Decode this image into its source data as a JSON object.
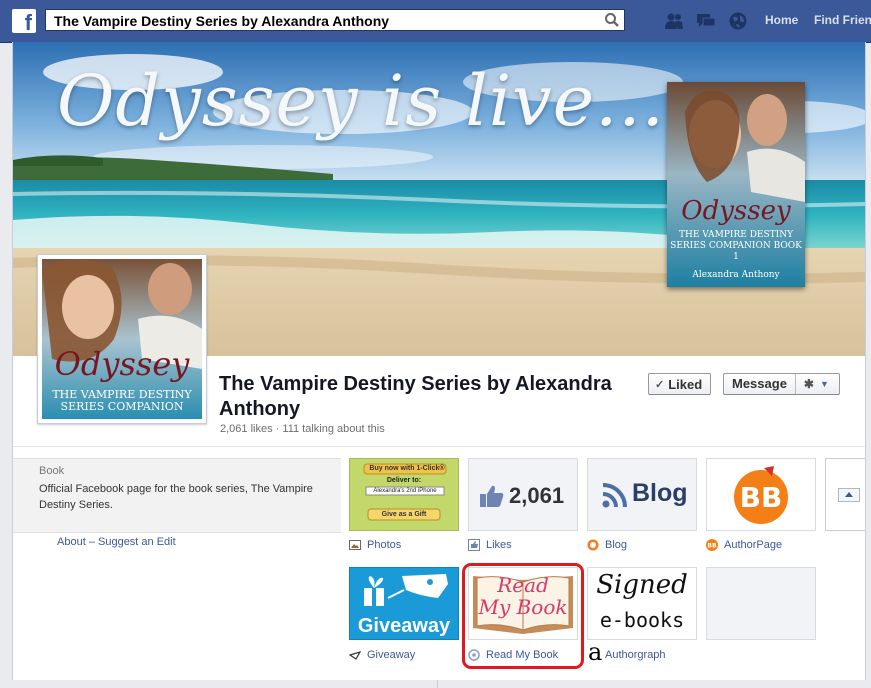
{
  "topbar": {
    "search_value": "The Vampire Destiny Series by Alexandra Anthony",
    "nav": [
      "Home",
      "Find Friends"
    ]
  },
  "cover": {
    "headline": "Odyssey is live...",
    "book_title": "Odyssey",
    "book_subtitle": "The Vampire Destiny Series Companion Book 1",
    "book_author": "Alexandra Anthony"
  },
  "profile": {
    "title": "Odyssey",
    "subtitle": "The Vampire Destiny Series Companion"
  },
  "page": {
    "name": "The Vampire Destiny Series by Alexandra Anthony",
    "likes": "2,061 likes",
    "separator": "·",
    "talking": "111 talking about this"
  },
  "actions": {
    "liked_check": "✓",
    "liked": "Liked",
    "message": "Message",
    "gear": "✱",
    "caret": "▼"
  },
  "about": {
    "category": "Book",
    "description": "Official Facebook page for the book series, The Vampire Destiny Series.",
    "about_link": "About",
    "separator": "–",
    "suggest_link": "Suggest an Edit"
  },
  "apps": {
    "photos": {
      "label": "Photos",
      "widget_buy": "Buy now with 1-Click®",
      "widget_deliver": "Deliver to:",
      "widget_device": "Alexandra's 2nd iPhone",
      "widget_gift": "Give as a Gift"
    },
    "likes": {
      "label": "Likes",
      "count": "2,061"
    },
    "blog": {
      "label": "Blog",
      "text": "Blog"
    },
    "authorpage": {
      "label": "AuthorPage",
      "logo": "BB"
    },
    "giveaway": {
      "label": "Giveaway",
      "text": "Giveaway"
    },
    "readmybook": {
      "label": "Read My Book",
      "line1": "Read",
      "line2": "My Book"
    },
    "authorgraph": {
      "label": "Authorgraph",
      "line1": "Signed",
      "line2": "e-books"
    }
  },
  "annotation": {
    "marker": "a",
    "color": "#e0191f"
  },
  "colors": {
    "brand": "#3b5998",
    "highlight": "#e0191f"
  }
}
